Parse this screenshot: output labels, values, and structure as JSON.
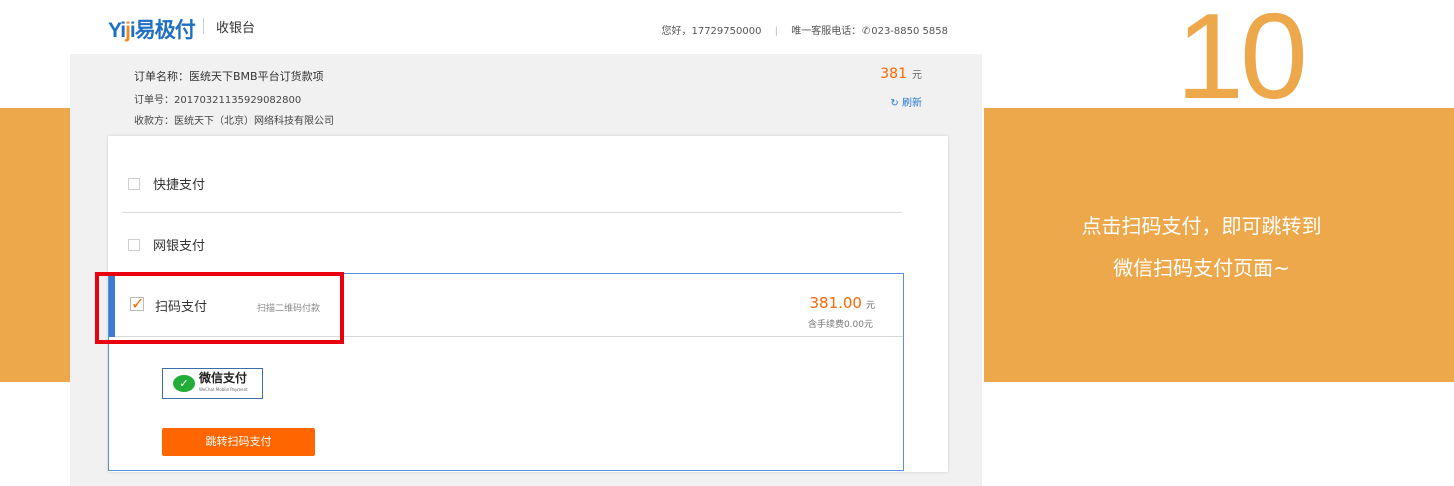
{
  "step": {
    "number": "10"
  },
  "callout": {
    "line1": "点击扫码支付，即可跳转到",
    "line2": "微信扫码支付页面~"
  },
  "header": {
    "logo_main": "Yiji",
    "logo_cn": "易极付",
    "cashier": "收银台",
    "greeting": "您好，17729750000",
    "hotline_label": "唯一客服电话：",
    "hotline": "023-8850 5858"
  },
  "order": {
    "name": "订单名称：医统天下BMB平台订货款项",
    "number": "订单号：2017032113592908280​0",
    "payee": "收款方：医统天下（北京）网络科技有限公司",
    "amount": "381",
    "unit": "元",
    "refresh": "刷新"
  },
  "methods": [
    {
      "label": "快捷支付",
      "checked": false
    },
    {
      "label": "网银支付",
      "checked": false
    }
  ],
  "qr_payment": {
    "label": "扫码支付",
    "checked": true,
    "hint": "扫描二维码付款",
    "amount": "381.00",
    "unit": "元",
    "fee": "含手续费0.00元",
    "wechat_label": "微信支付",
    "wechat_sub": "WeChat Mobile Payment",
    "button": "跳转扫码支付"
  },
  "colors": {
    "accent_orange": "#eca84b",
    "price_orange": "#ff6600",
    "brand_blue": "#1f6fc5",
    "highlight_red": "#e8000d"
  }
}
